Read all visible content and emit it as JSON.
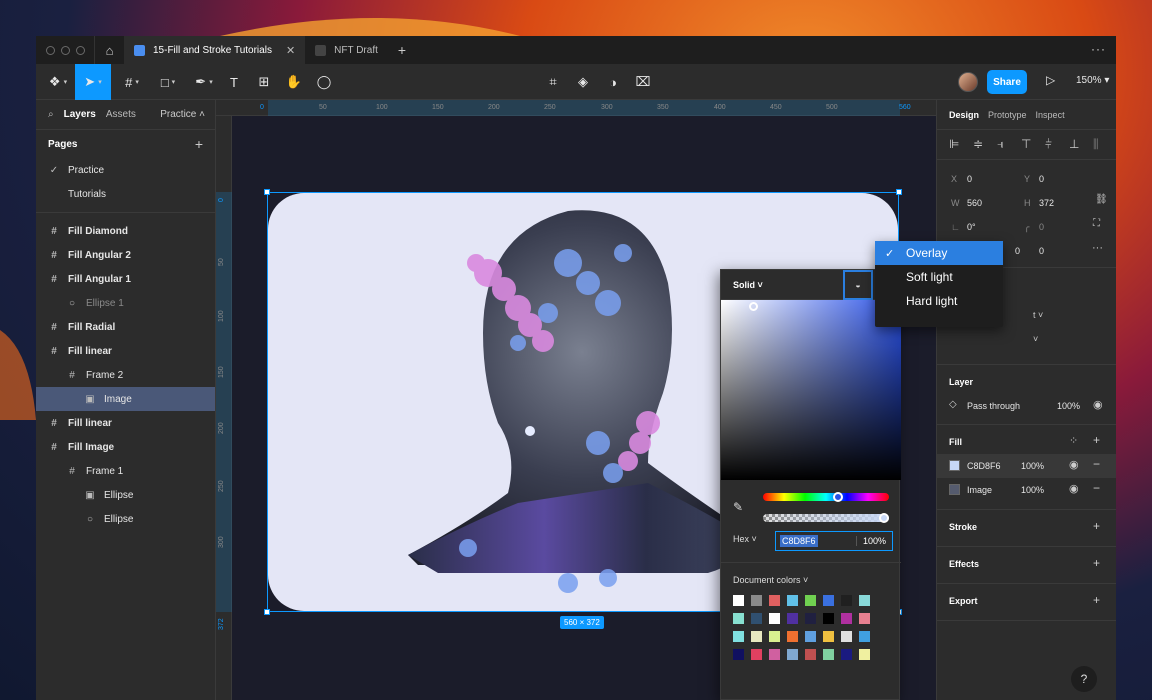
{
  "tabs": [
    {
      "label": "15-Fill and Stroke Tutorials",
      "active": true
    },
    {
      "label": "NFT Draft",
      "active": false
    }
  ],
  "toolbar": {
    "share_label": "Share",
    "zoom": "150%"
  },
  "left_panel": {
    "tab_layers": "Layers",
    "tab_assets": "Assets",
    "page_switch": "Practice",
    "pages_title": "Pages",
    "pages": [
      "Practice",
      "Tutorials"
    ],
    "layers": [
      {
        "label": "Fill Diamond",
        "type": "frame",
        "indent": 0
      },
      {
        "label": "Fill Angular  2",
        "type": "frame",
        "indent": 0
      },
      {
        "label": "Fill Angular 1",
        "type": "frame",
        "indent": 0
      },
      {
        "label": "Ellipse 1",
        "type": "ellipse",
        "indent": 1
      },
      {
        "label": "Fill Radial",
        "type": "frame",
        "indent": 0
      },
      {
        "label": "Fill linear",
        "type": "frame",
        "indent": 0
      },
      {
        "label": "Frame 2",
        "type": "frame",
        "indent": 1
      },
      {
        "label": "Image",
        "type": "image",
        "indent": 2
      },
      {
        "label": "Fill linear",
        "type": "frame",
        "indent": 0
      },
      {
        "label": "Fill Image",
        "type": "frame",
        "indent": 0
      },
      {
        "label": "Frame 1",
        "type": "frame",
        "indent": 1
      },
      {
        "label": "Ellipse",
        "type": "image",
        "indent": 2
      },
      {
        "label": "Ellipse",
        "type": "ellipse",
        "indent": 2
      }
    ]
  },
  "rulers": {
    "h": [
      "0",
      "50",
      "100",
      "150",
      "200",
      "250",
      "300",
      "350",
      "400",
      "450",
      "500",
      "560"
    ],
    "v": [
      "0",
      "50",
      "100",
      "150",
      "200",
      "250",
      "300",
      "372"
    ]
  },
  "canvas": {
    "dimensions": "560 × 372"
  },
  "right_panel": {
    "tabs": [
      "Design",
      "Prototype",
      "Inspect"
    ],
    "x": "560",
    "x_label": "X",
    "x_val": "0",
    "y_label": "Y",
    "y_val": "0",
    "w_label": "W",
    "w_val": "560",
    "h_label": "H",
    "h_val": "372",
    "rotation": "0°",
    "radius": [
      "0",
      "0",
      "0",
      "0"
    ],
    "layer_title": "Layer",
    "blend": "Pass through",
    "opacity": "100%",
    "fill_title": "Fill",
    "fills": [
      {
        "name": "C8D8F6",
        "opacity": "100%",
        "color": "#c8d8f6"
      },
      {
        "name": "Image",
        "opacity": "100%",
        "color": "#555b6e"
      }
    ],
    "stroke_title": "Stroke",
    "effects_title": "Effects",
    "export_title": "Export"
  },
  "blend_menu": [
    "Overlay",
    "Soft light",
    "Hard light"
  ],
  "picker": {
    "mode": "Solid",
    "hex_label": "Hex",
    "hex": "C8D8F6",
    "alpha": "100%",
    "doc_colors_label": "Document colors",
    "swatches": [
      "#ffffff",
      "#8a8a8a",
      "#e06060",
      "#60c0e8",
      "#70d050",
      "#3a70e0",
      "#202020",
      "#88d8d8",
      "#88e0d0",
      "#305070",
      "#ffffff",
      "#5030a0",
      "#202040",
      "#000000",
      "#b030a0",
      "#e88090",
      "#80e0e0",
      "#e8e8c0",
      "#d8f090",
      "#f07030",
      "#60a0e0",
      "#f0c040",
      "#e0e0e0",
      "#40a0e0",
      "#101060",
      "#e04060",
      "#d060a0",
      "#80a8d0",
      "#c05050",
      "#80d0a0",
      "#1a1a80",
      "#f0f0a0"
    ]
  },
  "colors": {
    "accent": "#0d99ff",
    "frame_fill": "#c8d8f6"
  }
}
